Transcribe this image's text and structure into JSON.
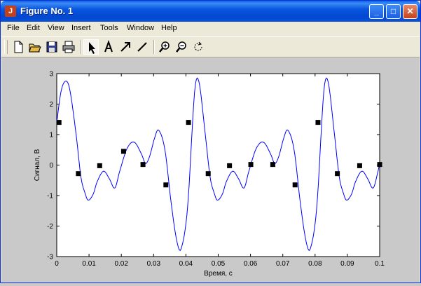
{
  "window": {
    "title": "Figure No. 1",
    "app_icon_glyph": "J"
  },
  "title_buttons": {
    "minimize": "_",
    "maximize": "□",
    "close": "✕"
  },
  "menu": [
    "File",
    "Edit",
    "View",
    "Insert",
    "Tools",
    "Window",
    "Help"
  ],
  "toolbar": [
    "new-file-icon",
    "open-folder-icon",
    "save-icon",
    "print-icon",
    "select-arrow-icon",
    "insert-text-icon",
    "insert-arrow-icon",
    "insert-line-icon",
    "zoom-in-icon",
    "zoom-out-icon",
    "rotate-icon"
  ],
  "colors": {
    "line": "#0000ff",
    "marker": "#000000",
    "figure_bg": "#c9c9c9",
    "axes_bg": "#ffffff"
  },
  "chart_data": {
    "type": "line",
    "xlabel": "Время, с",
    "ylabel": "Сигнал, В",
    "xlim": [
      0,
      0.1
    ],
    "ylim": [
      -3,
      3
    ],
    "xticks": [
      "0",
      "0.01",
      "0.02",
      "0.03",
      "0.04",
      "0.05",
      "0.06",
      "0.07",
      "0.08",
      "0.09",
      "0.1"
    ],
    "yticks": [
      "3",
      "2",
      "1",
      "0",
      "-1",
      "-2",
      "-3"
    ],
    "series": [
      {
        "style": "line",
        "color": "#0000ff",
        "x": [
          0,
          0.0013,
          0.0027,
          0.004,
          0.006,
          0.0075,
          0.0087,
          0.0097,
          0.0113,
          0.0125,
          0.0145,
          0.0163,
          0.018,
          0.0195,
          0.0218,
          0.024,
          0.0263,
          0.0275,
          0.0288,
          0.0302,
          0.0315,
          0.0335,
          0.0355,
          0.0372,
          0.0385,
          0.0405,
          0.0427,
          0.044,
          0.046,
          0.0475,
          0.0487,
          0.0497,
          0.0513,
          0.0525,
          0.0545,
          0.0563,
          0.058,
          0.0595,
          0.0618,
          0.064,
          0.0663,
          0.0675,
          0.0688,
          0.0702,
          0.0715,
          0.0735,
          0.0755,
          0.0772,
          0.0785,
          0.0805,
          0.0827,
          0.084,
          0.086,
          0.0875,
          0.0887,
          0.0897,
          0.0913,
          0.0925,
          0.0945,
          0.0963,
          0.098,
          0.0995,
          0.1
        ],
        "y": [
          1.4,
          2.4,
          2.75,
          2.5,
          1.0,
          -0.4,
          -0.9,
          -1.15,
          -0.95,
          -0.55,
          -0.2,
          -0.45,
          -0.75,
          -0.2,
          0.55,
          0.75,
          0.35,
          0.05,
          0.3,
          0.85,
          1.15,
          0.5,
          -1.3,
          -2.5,
          -2.75,
          -1.4,
          2.4,
          2.75,
          1.0,
          -0.4,
          -0.9,
          -1.15,
          -0.95,
          -0.55,
          -0.2,
          -0.45,
          -0.75,
          -0.2,
          0.55,
          0.75,
          0.35,
          0.05,
          0.3,
          0.85,
          1.15,
          0.5,
          -1.3,
          -2.5,
          -2.75,
          -1.4,
          2.4,
          2.75,
          1.0,
          -0.4,
          -0.9,
          -1.15,
          -0.95,
          -0.55,
          -0.2,
          -0.45,
          -0.75,
          -0.2,
          0.05
        ]
      },
      {
        "style": "markers",
        "color": "#000000",
        "x": [
          0.0007,
          0.0067,
          0.0133,
          0.0207,
          0.0267,
          0.0338,
          0.0408,
          0.0469,
          0.0535,
          0.0601,
          0.0669,
          0.0738,
          0.0809,
          0.0869,
          0.0938,
          0.1
        ],
        "y": [
          1.4,
          -0.28,
          -0.02,
          0.45,
          0.02,
          -0.65,
          1.4,
          -0.28,
          -0.02,
          0.02,
          0.02,
          -0.65,
          1.4,
          -0.28,
          -0.02,
          0.02
        ]
      }
    ]
  }
}
